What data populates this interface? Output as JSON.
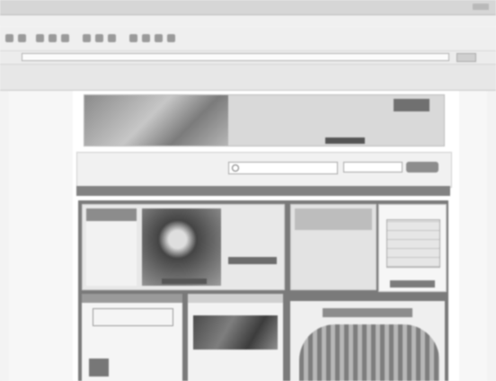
{
  "browser": {
    "title": "",
    "menu": [],
    "address_label": "",
    "url": "",
    "go_label": "",
    "links_pills": []
  },
  "site": {
    "banner": {
      "headline1": "",
      "headline2": "",
      "cta": "",
      "badge": ""
    },
    "logo": "",
    "logo_sub": "",
    "header_links": "",
    "search_scope": "",
    "search_button": "",
    "nav_items": [],
    "sidebar": {
      "header": "",
      "items": []
    },
    "hero": {
      "text": "",
      "button": "",
      "caption": ""
    },
    "middle": {
      "heading": "",
      "lines": []
    },
    "right": {
      "heading": "",
      "caption": "",
      "button": ""
    },
    "box1": {
      "header": "",
      "promo": "",
      "text": ""
    },
    "box2": {
      "header": "",
      "text": ""
    },
    "box3": {
      "header": ""
    }
  }
}
